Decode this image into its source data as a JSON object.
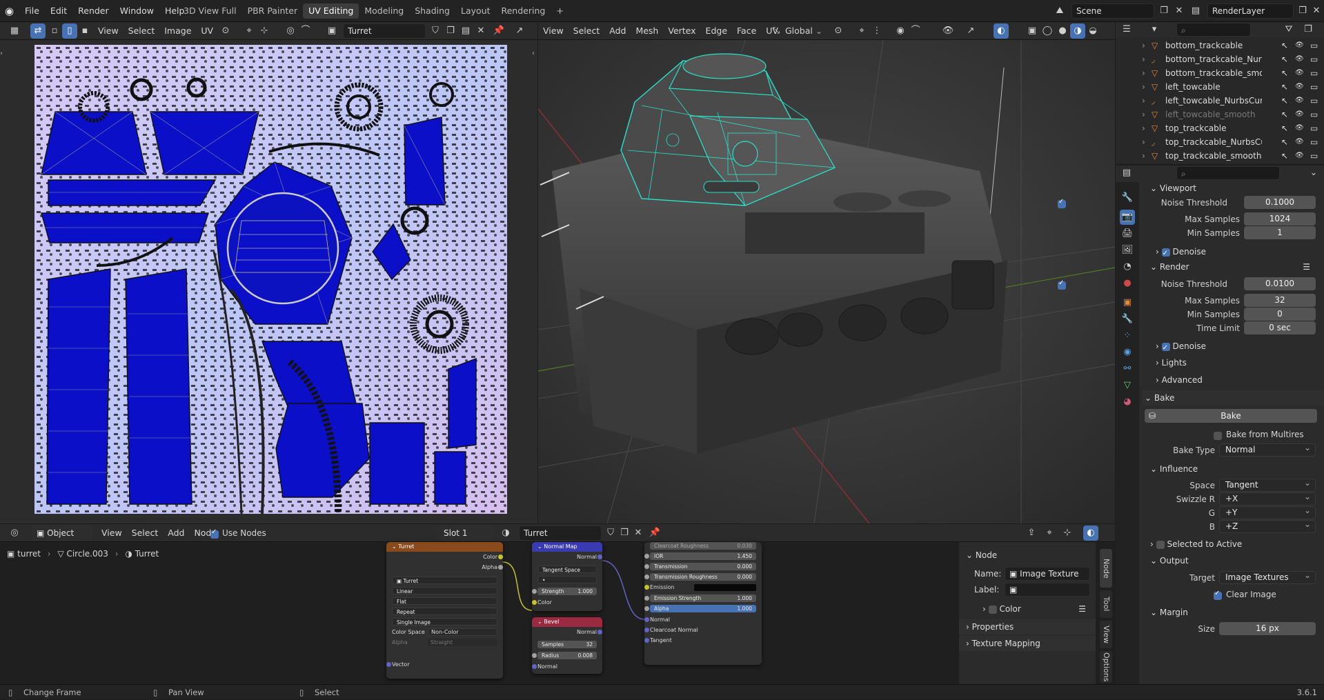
{
  "topbar": {
    "menus": [
      "File",
      "Edit",
      "Render",
      "Window",
      "Help"
    ],
    "workspaces": [
      "3D View Full",
      "PBR Painter",
      "UV Editing",
      "Modeling",
      "Shading",
      "Layout",
      "Rendering"
    ],
    "add_workspace": "+",
    "scene_label": "Scene",
    "render_layer": "RenderLayer"
  },
  "uv_editor": {
    "menus": [
      "View",
      "Select",
      "Image",
      "UV"
    ],
    "image_name": "Turret"
  },
  "viewport": {
    "menus": [
      "View",
      "Select",
      "Add",
      "Mesh",
      "Vertex",
      "Edge",
      "Face",
      "UV"
    ],
    "transform_orientation": "Global"
  },
  "outliner": {
    "items": [
      {
        "label": "bottom_trackcable",
        "icon": "mesh-icon",
        "dim": false
      },
      {
        "label": "bottom_trackcable_NurbsC",
        "icon": "curve-icon",
        "dim": false
      },
      {
        "label": "bottom_trackcable_smoo",
        "icon": "mesh-icon",
        "dim": false
      },
      {
        "label": "left_towcable",
        "icon": "mesh-icon",
        "dim": false
      },
      {
        "label": "left_towcable_NurbsCurve",
        "icon": "curve-icon",
        "dim": false
      },
      {
        "label": "left_towcable_smooth",
        "icon": "mesh-icon",
        "dim": true
      },
      {
        "label": "top_trackcable",
        "icon": "mesh-icon",
        "dim": false
      },
      {
        "label": "top_trackcable_NurbsCur",
        "icon": "curve-icon",
        "dim": false
      },
      {
        "label": "top_trackcable_smooth",
        "icon": "mesh-icon",
        "dim": false
      }
    ]
  },
  "properties": {
    "viewport_section": "Viewport",
    "vp_noise_threshold_label": "Noise Threshold",
    "vp_noise_threshold": "0.1000",
    "vp_max_samples_label": "Max Samples",
    "vp_max_samples": "1024",
    "vp_min_samples_label": "Min Samples",
    "vp_min_samples": "1",
    "vp_denoise": "Denoise",
    "render_section": "Render",
    "r_noise_threshold_label": "Noise Threshold",
    "r_noise_threshold": "0.0100",
    "r_max_samples_label": "Max Samples",
    "r_max_samples": "32",
    "r_min_samples_label": "Min Samples",
    "r_min_samples": "0",
    "r_time_limit_label": "Time Limit",
    "r_time_limit": "0 sec",
    "r_denoise": "Denoise",
    "lights": "Lights",
    "advanced": "Advanced",
    "bake_section": "Bake",
    "bake_button": "Bake",
    "bake_from_multires": "Bake from Multires",
    "bake_type_label": "Bake Type",
    "bake_type": "Normal",
    "influence": "Influence",
    "space_label": "Space",
    "space": "Tangent",
    "swizzle_r_label": "Swizzle R",
    "swizzle_r": "+X",
    "g_label": "G",
    "g": "+Y",
    "b_label": "B",
    "b": "+Z",
    "selected_to_active": "Selected to Active",
    "output": "Output",
    "target_label": "Target",
    "target": "Image Textures",
    "clear_image": "Clear Image",
    "margin": "Margin",
    "size_label": "Size",
    "size": "16 px"
  },
  "node_editor": {
    "object_mode": "Object",
    "menus": [
      "View",
      "Select",
      "Add",
      "Node"
    ],
    "use_nodes": "Use Nodes",
    "slot": "Slot 1",
    "material": "Turret",
    "breadcrumb": [
      "turret",
      "Circle.003",
      "Turret"
    ],
    "image_node": {
      "title": "Turret",
      "out_color": "Color",
      "out_alpha": "Alpha",
      "image": "Turret",
      "interpolation": "Linear",
      "projection": "Flat",
      "extension": "Repeat",
      "source": "Single Image",
      "color_space_label": "Color Space",
      "color_space": "Non-Color",
      "alpha_label": "Alpha",
      "alpha": "Straight",
      "vector": "Vector"
    },
    "normal_map": {
      "title": "Normal Map",
      "out_normal": "Normal",
      "space": "Tangent Space",
      "uv": "•",
      "strength_label": "Strength",
      "strength": "1.000",
      "in_color": "Color"
    },
    "bevel": {
      "title": "Bevel",
      "out_normal": "Normal",
      "samples_label": "Samples",
      "samples": "32",
      "radius_label": "Radius",
      "radius": "0.008",
      "in_normal": "Normal"
    },
    "bsdf": {
      "clearcoat_roughness_label": "Clearcoat Roughness",
      "clearcoat_roughness": "0.030",
      "ior_label": "IOR",
      "ior": "1.450",
      "transmission_label": "Transmission",
      "transmission": "0.000",
      "transmission_roughness_label": "Transmission Roughness",
      "transmission_roughness": "0.000",
      "emission": "Emission",
      "emission_strength_label": "Emission Strength",
      "emission_strength": "1.000",
      "alpha_label": "Alpha",
      "alpha": "1.000",
      "normal": "Normal",
      "clearcoat_normal": "Clearcoat Normal",
      "tangent": "Tangent"
    },
    "sidebar": {
      "node_section": "Node",
      "name_label": "Name:",
      "name": "Image Texture",
      "label_label": "Label:",
      "label": "",
      "color": "Color",
      "properties": "Properties",
      "texture_mapping": "Texture Mapping",
      "tabs": [
        "Node",
        "Tool",
        "View",
        "Options"
      ]
    }
  },
  "statusbar": {
    "change_frame": "Change Frame",
    "pan_view": "Pan View",
    "select": "Select",
    "version": "3.6.1"
  },
  "colors": {
    "accent": "#4772b3",
    "uv_blue": "#0c14c8",
    "uv_bg": "#c9bff0",
    "wire": "#27e3c8",
    "image_node_head": "#8a4b1c",
    "normal_node_head": "#3a3bb0",
    "bevel_node_head": "#9b2940"
  }
}
